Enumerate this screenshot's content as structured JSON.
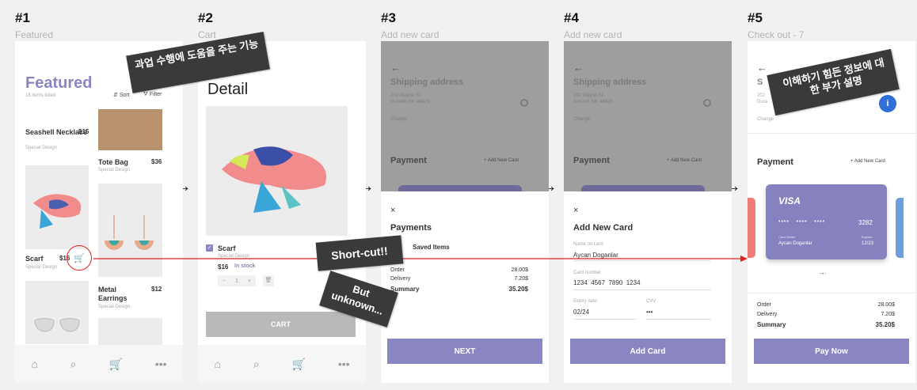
{
  "steps": [
    {
      "num": "#1",
      "title": "Featured"
    },
    {
      "num": "#2",
      "title": "Cart"
    },
    {
      "num": "#3",
      "title": "Add new card"
    },
    {
      "num": "#4",
      "title": "Add new card"
    },
    {
      "num": "#5",
      "title": "Check out - 7"
    }
  ],
  "screen1": {
    "title": "Featured",
    "count": "18 items listed",
    "sort": "Sort",
    "filter": "Filter",
    "products": [
      {
        "name": "Seashell Necklace",
        "price": "$15",
        "brand": "Special Design"
      },
      {
        "name": "Tote Bag",
        "price": "$36",
        "brand": "Special Design"
      },
      {
        "name": "Scarf",
        "price": "$16",
        "brand": "Special Design"
      },
      {
        "name": "Metal Earrings",
        "price": "$12",
        "brand": "Special Design"
      }
    ]
  },
  "screen2": {
    "title": "Detail",
    "item_name": "Scarf",
    "item_brand": "Special Design",
    "item_price": "$16",
    "stock": "In stock",
    "qty_minus": "−",
    "qty": "1",
    "qty_plus": "+",
    "cart_button": "CART"
  },
  "screen3": {
    "back": "←",
    "shipping_title": "Shipping address",
    "address_line1": "202 Wayne St.",
    "address_line2": "Durand, MI, 48429",
    "change": "Change",
    "payment_title": "Payment",
    "add_new_card": "+ Add New Card",
    "close": "×",
    "sheet_title": "Payments",
    "sheet_sub": "Saved Items",
    "order_label": "Order",
    "order_value": "28.00$",
    "delivery_label": "Delivery",
    "delivery_value": "7.20$",
    "summary_label": "Summary",
    "summary_value": "35.20$",
    "next_button": "NEXT"
  },
  "screen4": {
    "back": "←",
    "shipping_title": "Shipping address",
    "address_line1": "202 Wayne St.",
    "address_line2": "Durand, MI, 48429",
    "change": "Change",
    "payment_title": "Payment",
    "add_new_card": "+ Add New Card",
    "close": "×",
    "sheet_title": "Add New Card",
    "name_label": "Name on card",
    "name_value": "Aycan Doganlar",
    "number_label": "Card number",
    "number_value": "1234  4567  7890  1234",
    "expiry_label": "Expiry date",
    "expiry_value": "02/24",
    "cvv_label": "CVV",
    "cvv_value": "•••",
    "add_card_button": "Add Card"
  },
  "screen5": {
    "back": "←",
    "shipping_initial": "S",
    "address_short1": "202",
    "address_short2": "Dura",
    "change": "Change",
    "info_icon": "i",
    "payment_title": "Payment",
    "add_new_card": "+ Add New Card",
    "card_brand": "VISA",
    "card_masked": "••••   ••••   ••••",
    "card_last4": "3282",
    "holder_label": "Card Holder",
    "holder_name": "Aycan Doganlar",
    "expires_label": "Expires",
    "expires_value": "12/23",
    "order_label": "Order",
    "order_value": "28.00$",
    "delivery_label": "Delivery",
    "delivery_value": "7.20$",
    "summary_label": "Summary",
    "summary_value": "35.20$",
    "pay_button": "Pay Now"
  },
  "notes": {
    "n1": "과업 수행에 도움을 주는 기능",
    "n2": "이해하기 힘든 정보에 대한 부가 설명",
    "n3": "Short-cut!!",
    "n4": "But unknown..."
  },
  "arrow_glyph": "→",
  "colors": {
    "accent": "#8a86c2",
    "shortcut_red": "#e02020",
    "card_purple": "#8682c0",
    "info_blue": "#2f6fd6"
  }
}
